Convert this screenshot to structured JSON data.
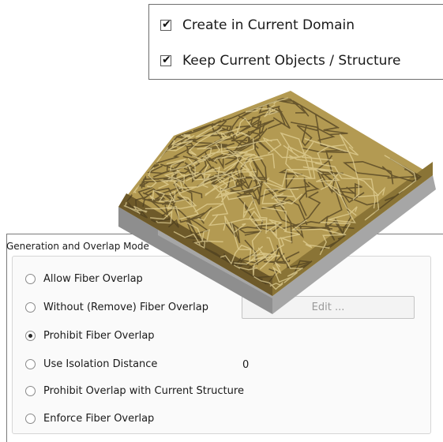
{
  "options": {
    "create_in_domain": {
      "label": "Create in Current Domain",
      "checked": true
    },
    "keep_objects": {
      "label": "Keep Current Objects / Structure",
      "checked": true
    }
  },
  "overlap_mode": {
    "title": "Generation and Overlap Mode",
    "items": [
      {
        "label": "Allow Fiber Overlap",
        "selected": false
      },
      {
        "label": "Without (Remove) Fiber Overlap",
        "selected": false
      },
      {
        "label": "Prohibit Fiber Overlap",
        "selected": true
      },
      {
        "label": "Use Isolation Distance",
        "selected": false
      },
      {
        "label": "Prohibit Overlap with Current Structure",
        "selected": false
      },
      {
        "label": "Enforce Fiber Overlap",
        "selected": false
      }
    ],
    "isolation_value": "0",
    "edit_label": "Edit ..."
  },
  "colors": {
    "fiber": "#b39a52",
    "fiber_dark": "#6e5a2a",
    "base": "#8f8f8f"
  }
}
